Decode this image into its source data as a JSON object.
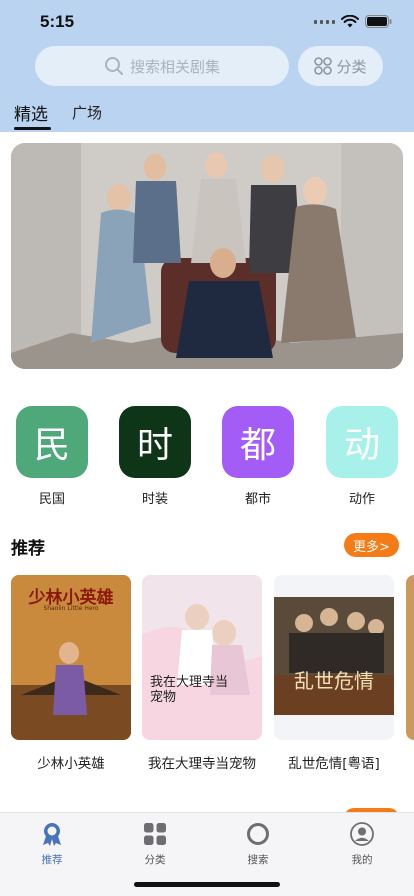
{
  "status": {
    "time": "5:15"
  },
  "search": {
    "placeholder": "搜索相关剧集",
    "icon": "search-icon"
  },
  "category_button": {
    "label": "分类",
    "icon": "grid-icon"
  },
  "tabs": [
    {
      "label": "精选",
      "selected": true
    },
    {
      "label": "广场",
      "selected": false
    }
  ],
  "genres": [
    {
      "char": "民",
      "label": "民国",
      "color": "#4fa87a"
    },
    {
      "char": "时",
      "label": "时装",
      "color": "#0f3518"
    },
    {
      "char": "都",
      "label": "都市",
      "color": "#a35cf6"
    },
    {
      "char": "动",
      "label": "动作",
      "color": "#a8f1ea"
    }
  ],
  "recommend": {
    "title": "推荐",
    "more_label": "更多>",
    "items": [
      {
        "title": "少林小英雄",
        "poster_text": "少林小英雄",
        "poster_subtext": "Shaolin Little Hero"
      },
      {
        "title": "我在大理寺当宠物",
        "poster_text": "我在大理寺当宠物"
      },
      {
        "title": "乱世危情[粤语]",
        "poster_text": "乱世危情"
      }
    ]
  },
  "bottom_nav": [
    {
      "label": "推荐",
      "icon": "badge-icon",
      "active": true
    },
    {
      "label": "分类",
      "icon": "grid-icon",
      "active": false
    },
    {
      "label": "搜索",
      "icon": "search-ring-icon",
      "active": false
    },
    {
      "label": "我的",
      "icon": "profile-icon",
      "active": false
    }
  ],
  "colors": {
    "header_bg": "#b9d3f1",
    "accent_orange": "#f47b16",
    "nav_active": "#4a74b8"
  }
}
